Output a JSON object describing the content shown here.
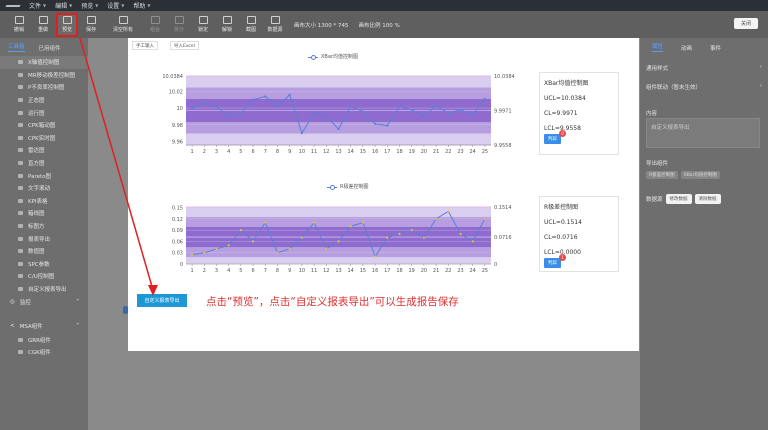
{
  "menu": [
    "文件",
    "编辑",
    "预览",
    "设置",
    "帮助"
  ],
  "toolbar": {
    "buttons": [
      {
        "label": "撤销",
        "dim": false
      },
      {
        "label": "重做",
        "dim": false
      },
      {
        "label": "预览",
        "dim": false
      },
      {
        "label": "保存",
        "dim": false
      },
      {
        "label": "清空所有",
        "dim": false
      },
      {
        "label": "组合",
        "dim": true
      },
      {
        "label": "拆分",
        "dim": true
      },
      {
        "label": "锁定",
        "dim": false
      },
      {
        "label": "解锁",
        "dim": false
      },
      {
        "label": "截图",
        "dim": false
      },
      {
        "label": "数据源",
        "dim": false
      }
    ],
    "canvas_size_text": "画布大小 1300 * 745",
    "ratio_text": "画布比例 100 %",
    "close_label": "关闭"
  },
  "left_panel": {
    "tabs": [
      "工具箱",
      "已用组件"
    ],
    "items": [
      "X轴值控制图",
      "MR移动极差控制图",
      "P不良率控制图",
      "正态图",
      "运行图",
      "CPK箱动图",
      "CPK实时图",
      "雷达图",
      "直方图",
      "Pareto图",
      "文字滚动",
      "KPI表格",
      "箱线图",
      "标图方",
      "报表导出",
      "数值图",
      "SPC参数",
      "C/U控制图",
      "自定义报表导出"
    ],
    "group_monitor": "监控",
    "group_msa": "MSA组件",
    "msa_items": [
      "GRR组件",
      "CGK组件"
    ]
  },
  "canvas": {
    "btn_manual": "手工输入",
    "btn_import": "导入Excel",
    "export_button": "自定义报表导出",
    "instruction": "点击“预览”，点击“自定义报表导出”可以生成报告保存"
  },
  "xbar": {
    "legend": "XBar均值控制图",
    "stat_title": "XBar均值控制图",
    "ucl_text": "UCL=10.0384",
    "cl_text": "CL=9.9971",
    "lcl_text": "LCL=9.9558",
    "judge_btn": "判异",
    "badge": "0",
    "y_ticks": [
      "10.0384",
      "10.02",
      "10",
      "9.98",
      "9.96"
    ],
    "ucl_label": "10.0384",
    "cl_label": "9.9971",
    "lcl_label": "9.9558"
  },
  "range": {
    "legend": "R极差控制图",
    "stat_title": "R极差控制图",
    "ucl_text": "UCL=0.1514",
    "cl_text": "CL=0.0716",
    "lcl_text": "LCL=0.0000",
    "judge_btn": "判异",
    "badge": "1",
    "y_ticks": [
      "0.15",
      "0.12",
      "0.09",
      "0.06",
      "0.03",
      "0"
    ],
    "ucl_label": "0.1514",
    "cl_label": "0.0716",
    "lcl_label": "0"
  },
  "right_panel": {
    "tabs": [
      "属性",
      "动画",
      "事件"
    ],
    "row1": "通用样式",
    "row2": "组件联动（暂未生效）",
    "content_label": "内容",
    "content_value": "自定义报表导出",
    "linked_label": "导出组件",
    "chips": [
      "R极差控制图",
      "XBar均值控制图"
    ],
    "datasource_label": "数据源",
    "btn_modify": "修改数据",
    "btn_clear": "清除数据"
  },
  "chart_data": [
    {
      "type": "line",
      "title": "XBar均值控制图",
      "x": [
        1,
        2,
        3,
        4,
        5,
        6,
        7,
        8,
        9,
        10,
        11,
        12,
        13,
        14,
        15,
        16,
        17,
        18,
        19,
        20,
        21,
        22,
        23,
        24,
        25
      ],
      "series": [
        {
          "name": "XBar均值控制图",
          "values": [
            10.0,
            10.006,
            10.002,
            9.99,
            9.994,
            10.01,
            10.014,
            10.002,
            10.016,
            9.97,
            9.994,
            9.99,
            9.975,
            10.002,
            9.996,
            9.981,
            9.979,
            10.002,
            9.998,
            9.99,
            10.003,
            9.994,
            9.998,
            9.992,
            10.011
          ]
        }
      ],
      "ucl": 10.0384,
      "cl": 9.9971,
      "lcl": 9.9558,
      "ylim": [
        9.9558,
        10.0384
      ]
    },
    {
      "type": "line",
      "title": "R极差控制图",
      "x": [
        1,
        2,
        3,
        4,
        5,
        6,
        7,
        8,
        9,
        10,
        11,
        12,
        13,
        14,
        15,
        16,
        17,
        18,
        19,
        20,
        21,
        22,
        23,
        24,
        25
      ],
      "series": [
        {
          "name": "R极差控制图",
          "values": [
            0.025,
            0.03,
            0.04,
            0.05,
            0.09,
            0.06,
            0.11,
            0.03,
            0.04,
            0.07,
            0.11,
            0.04,
            0.06,
            0.1,
            0.11,
            0.02,
            0.07,
            0.08,
            0.09,
            0.07,
            0.12,
            0.14,
            0.08,
            0.06,
            0.12
          ]
        }
      ],
      "ucl": 0.1514,
      "cl": 0.0716,
      "lcl": 0,
      "ylim": [
        0,
        0.15
      ]
    }
  ]
}
